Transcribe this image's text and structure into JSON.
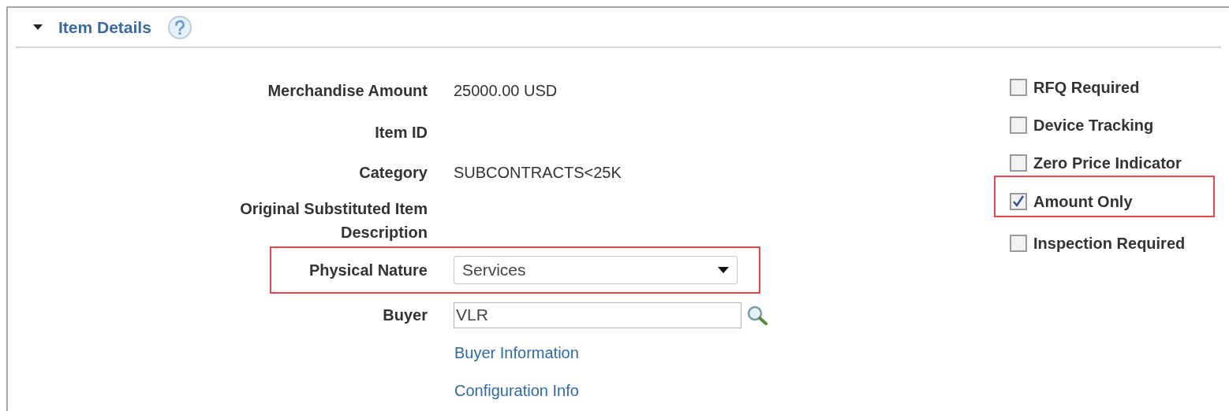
{
  "section": {
    "title": "Item Details",
    "expanded": true
  },
  "fields": [
    {
      "label": "Merchandise Amount",
      "kind": "text",
      "value": "25000.00 USD"
    },
    {
      "label": "Item ID",
      "kind": "text"
    },
    {
      "label": "Category",
      "kind": "text",
      "value": "SUBCONTRACTS<25K"
    },
    {
      "label": "Original Substituted Item Description",
      "kind": "text"
    },
    {
      "label": "Physical Nature",
      "kind": "select",
      "value": "Services",
      "highlighted": true
    },
    {
      "label": "Buyer",
      "kind": "lookup",
      "value": "VLR"
    }
  ],
  "links": [
    "Buyer Information",
    "Configuration Info"
  ],
  "options": [
    {
      "label": "RFQ Required",
      "checked": false,
      "highlighted": false
    },
    {
      "label": "Device Tracking",
      "checked": false,
      "highlighted": false
    },
    {
      "label": "Zero Price Indicator",
      "checked": false,
      "highlighted": false
    },
    {
      "label": "Amount Only",
      "checked": true,
      "highlighted": true
    },
    {
      "label": "Inspection Required",
      "checked": false,
      "highlighted": false
    }
  ]
}
